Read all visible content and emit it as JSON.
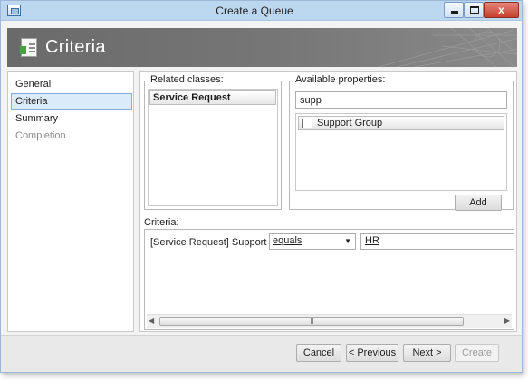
{
  "window": {
    "title": "Create a Queue",
    "close_glyph": "x"
  },
  "header": {
    "title": "Criteria",
    "icon": "checklist-document-icon"
  },
  "nav": {
    "items": [
      {
        "label": "General",
        "state": "normal"
      },
      {
        "label": "Criteria",
        "state": "selected"
      },
      {
        "label": "Summary",
        "state": "normal"
      },
      {
        "label": "Completion",
        "state": "disabled"
      }
    ]
  },
  "related": {
    "label": "Related classes:",
    "items": [
      "Service Request"
    ]
  },
  "properties": {
    "label": "Available properties:",
    "search_value": "supp",
    "items": [
      {
        "label": "Support Group",
        "checked": false
      }
    ],
    "add_label": "Add"
  },
  "criteria": {
    "label": "Criteria:",
    "row": {
      "field": "[Service Request] Support Group",
      "operator": "equals",
      "value": "HR"
    }
  },
  "footer": {
    "cancel_label": "Cancel",
    "previous_label": "< Previous",
    "next_label": "Next >",
    "create_label": "Create"
  },
  "colors": {
    "titlebar": "#bcd8f1",
    "header": "#777777",
    "selection": "#dcebfa",
    "close_button": "#c7402e"
  }
}
